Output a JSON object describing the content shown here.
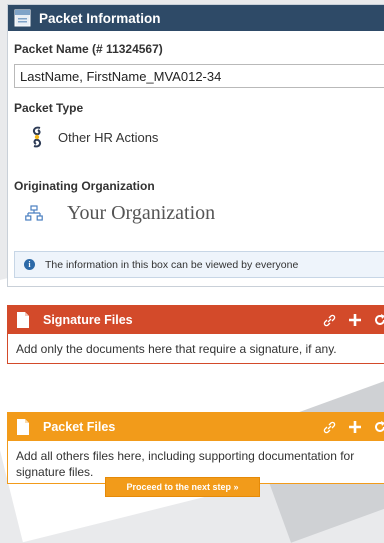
{
  "info_panel": {
    "title": "Packet Information",
    "packet_name_label": "Packet Name (# 11324567)",
    "packet_name_value": "LastName, FirstName_MVA012-34",
    "packet_type_label": "Packet Type",
    "packet_type_value": "Other HR Actions",
    "org_label": "Originating Organization",
    "org_value": "Your Organization",
    "note_text": "The information in this box can be viewed by everyone",
    "note_icon": "info-icon"
  },
  "signature_panel": {
    "title": "Signature Files",
    "description": "Add only the documents here that require a signature, if any.",
    "color": "#d34a2a",
    "actions": [
      "link-icon",
      "plus-icon",
      "refresh-icon"
    ]
  },
  "packet_files_panel": {
    "title": "Packet Files",
    "description": "Add all others files here, including supporting documentation for signature files.",
    "color": "#f29b1a",
    "actions": [
      "link-icon",
      "plus-icon",
      "refresh-icon"
    ]
  },
  "proceed_button": {
    "label": "Proceed to the next step »",
    "color": "#f29b1a"
  },
  "colors": {
    "header_dark": "#2e4a67",
    "signature": "#d34a2a",
    "packet": "#f29b1a"
  }
}
